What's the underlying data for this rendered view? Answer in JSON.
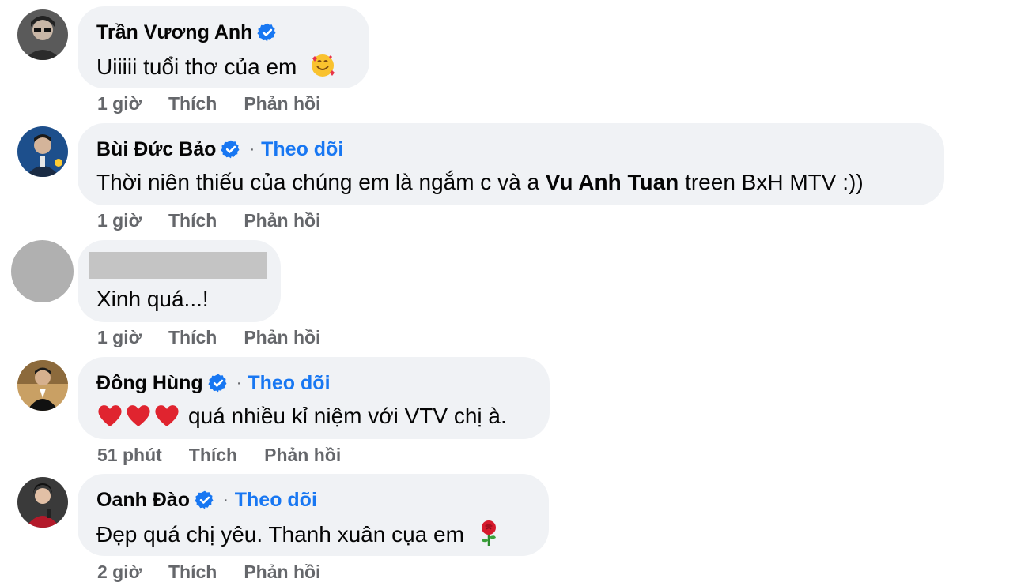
{
  "comments": [
    {
      "name": "Trần Vương Anh",
      "verified": true,
      "follow": "",
      "text": "Uiiiii tuổi thơ của em",
      "emoji": "smiling-face-with-hearts",
      "time": "1 giờ",
      "like": "Thích",
      "reply": "Phản hồi"
    },
    {
      "name": "Bùi Đức Bảo",
      "verified": true,
      "follow": "Theo dõi",
      "text_before": "Thời niên thiếu của chúng em là ngắm c và a ",
      "text_bold": "Vu Anh Tuan",
      "text_after": " treen BxH MTV :))",
      "time": "1 giờ",
      "like": "Thích",
      "reply": "Phản hồi"
    },
    {
      "name": "",
      "verified": false,
      "follow": "",
      "text": "Xinh quá...!",
      "time": "1 giờ",
      "like": "Thích",
      "reply": "Phản hồi"
    },
    {
      "name": "Đông Hùng",
      "verified": true,
      "follow": "Theo dõi",
      "text": "quá nhiều kỉ niệm với VTV chị à.",
      "emoji": "red-heart x3",
      "time": "51 phút",
      "like": "Thích",
      "reply": "Phản hồi"
    },
    {
      "name": "Oanh Đào",
      "verified": true,
      "follow": "Theo dõi",
      "text": "Đẹp quá chị yêu. Thanh xuân cụa em",
      "emoji": "rose",
      "time": "2 giờ",
      "like": "Thích",
      "reply": "Phản hồi"
    }
  ],
  "colors": {
    "bubble": "#f0f2f5",
    "link": "#1877f2",
    "muted": "#65676b",
    "verified": "#1877f2"
  }
}
